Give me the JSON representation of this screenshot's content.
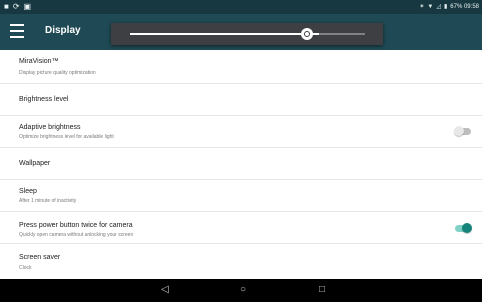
{
  "status_bar": {
    "left_icons": [
      "notification-icon",
      "sync-icon",
      "image-icon"
    ],
    "right_text": "67%  09:58",
    "right_icons": [
      "bluetooth-icon",
      "wifi-icon",
      "signal-icon",
      "battery-icon"
    ]
  },
  "app_bar": {
    "title": "Display"
  },
  "brightness_slider": {
    "level": 0.78,
    "icon": "brightness-icon"
  },
  "settings": [
    {
      "title": "MiraVision™",
      "subtitle": "Display picture quality optimization"
    },
    {
      "title": "Brightness level",
      "subtitle": ""
    },
    {
      "title": "Adaptive brightness",
      "subtitle": "Optimize brightness level for available light",
      "toggle": "off"
    },
    {
      "title": "Wallpaper",
      "subtitle": ""
    },
    {
      "title": "Sleep",
      "subtitle": "After 1 minute of inactivity"
    },
    {
      "title": "Press power button twice for camera",
      "subtitle": "Quickly open camera without unlocking your screen",
      "toggle": "on"
    },
    {
      "title": "Screen saver",
      "subtitle": "Clock"
    }
  ],
  "nav_bar": {
    "buttons": [
      "back-icon",
      "home-icon",
      "recents-icon"
    ]
  },
  "colors": {
    "accent": "#15857c",
    "status_bar": "#173840",
    "app_bar": "#1f4a55"
  }
}
